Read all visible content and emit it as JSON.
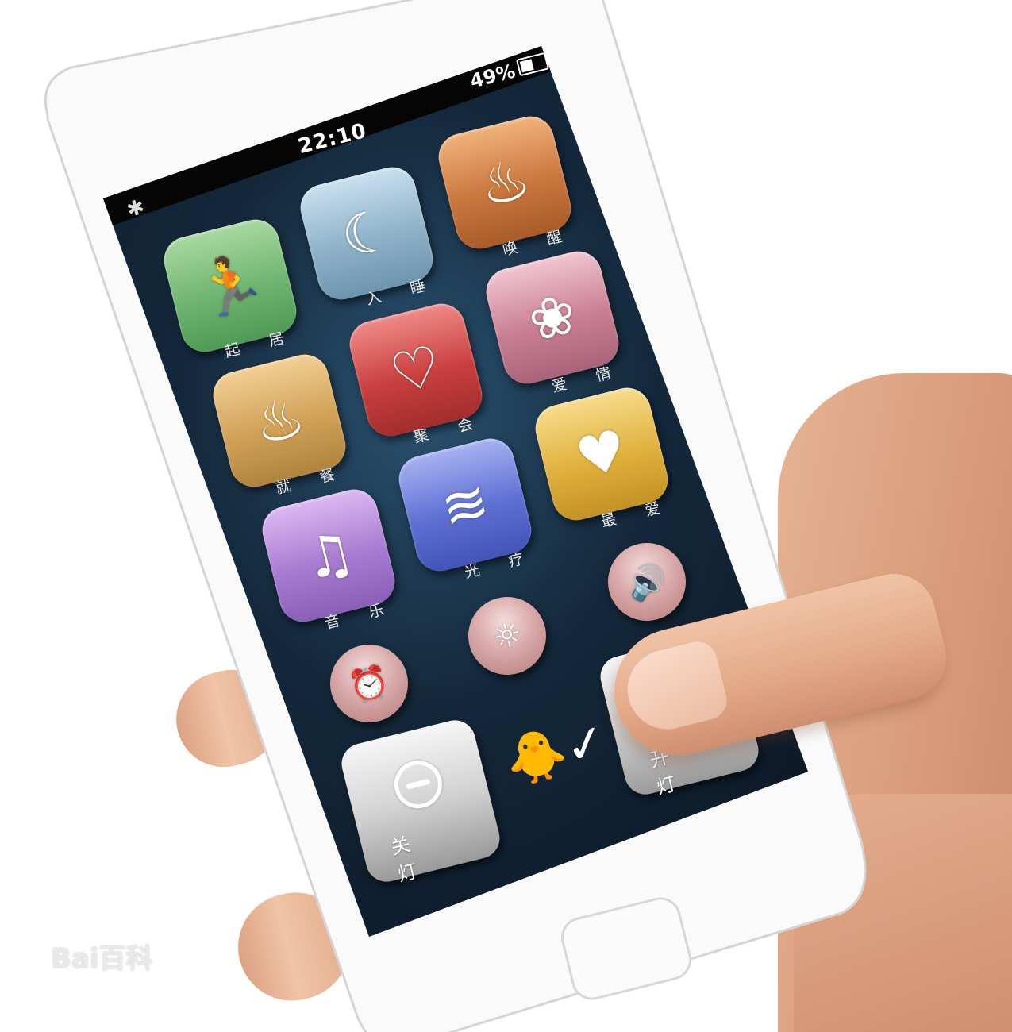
{
  "status_bar": {
    "time": "22:10",
    "battery": "49%",
    "bluetooth_icon": "bluetooth-icon",
    "battery_icon": "battery-icon"
  },
  "apps": [
    {
      "label": "起 居",
      "icon": "running-person-icon",
      "color": "#6fb56f"
    },
    {
      "label": "入 睡",
      "icon": "moon-icon",
      "color": "#8fb2c9"
    },
    {
      "label": "唤 醒",
      "icon": "rooster-icon",
      "color": "#c9773d"
    },
    {
      "label": "爱 情",
      "icon": "rose-icon",
      "color": "#c97f93"
    },
    {
      "label": "聚 会",
      "icon": "balloons-icon",
      "color": "#c9403f"
    },
    {
      "label": "就 餐",
      "icon": "dinner-icon",
      "color": "#d1a157"
    },
    {
      "label": "最 爱",
      "icon": "favorite-heart-icon",
      "color": "#e0b13e"
    },
    {
      "label": "光 疗",
      "icon": "light-therapy-icon",
      "color": "#5f70d3"
    },
    {
      "label": "音 乐",
      "icon": "music-icon",
      "color": "#a77bd0"
    }
  ],
  "round_buttons": [
    {
      "icon": "volume-icon"
    },
    {
      "icon": "brightness-icon"
    },
    {
      "icon": "alarm-clock-icon"
    }
  ],
  "bottom": {
    "off_label": "关 灯",
    "on_label": "开 灯",
    "mascot_icon": "bird-mascot-icon"
  },
  "watermark": "Bai百科"
}
